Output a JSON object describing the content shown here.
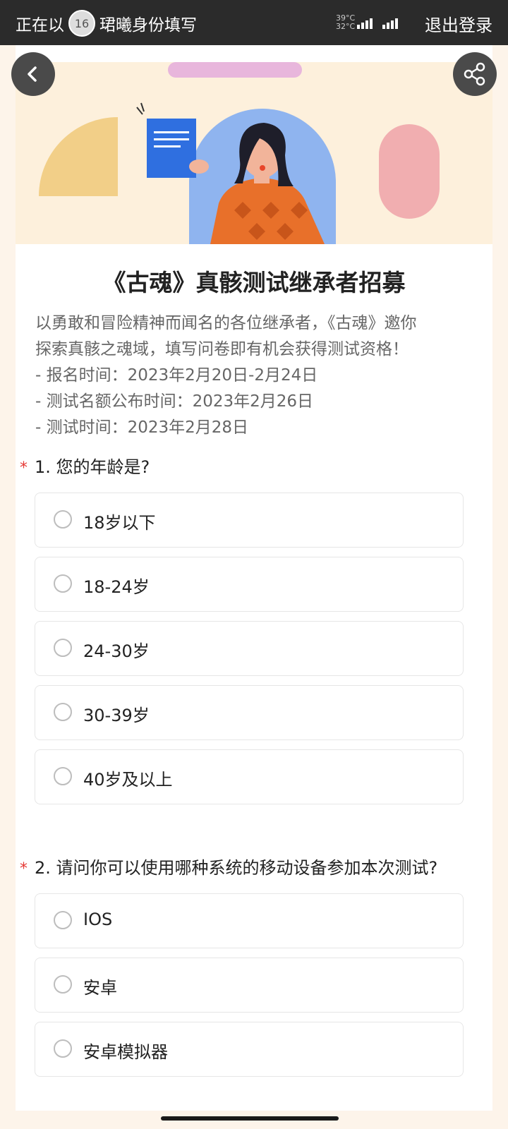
{
  "status_bar": {
    "left_text": "正在以",
    "avatar_text": "16",
    "identity_text": "珺曦身份填写",
    "temp_high": "39°C",
    "temp_low": "32°C",
    "logout": "退出登录"
  },
  "survey": {
    "title": "《古魂》真骸测试继承者招募",
    "intro_lines": [
      "以勇敢和冒险精神而闻名的各位继承者，《古魂》邀你",
      "探索真骸之魂域，填写问卷即有机会获得测试资格！",
      "- 报名时间：2023年2月20日-2月24日",
      "- 测试名额公布时间：2023年2月26日",
      "- 测试时间：2023年2月28日"
    ],
    "questions": [
      {
        "required_mark": "*",
        "label": "1. 您的年龄是?",
        "options": [
          "18岁以下",
          "18-24岁",
          "24-30岁",
          "30-39岁",
          "40岁及以上"
        ]
      },
      {
        "required_mark": "*",
        "label": "2. 请问你可以使用哪种系统的移动设备参加本次测试?",
        "options": [
          "IOS",
          "安卓",
          "安卓模拟器"
        ]
      }
    ]
  },
  "icons": {
    "back": "chevron-left-icon",
    "share": "share-icon"
  },
  "colors": {
    "required": "#e53935",
    "banner_bg": "#fdf0dc",
    "status_bar": "#2b2b2b"
  }
}
